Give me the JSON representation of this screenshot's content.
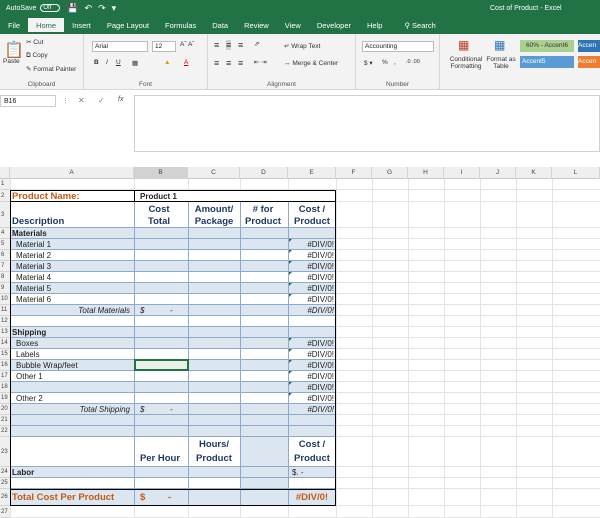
{
  "titlebar": {
    "autosave_label": "AutoSave",
    "autosave_state": "Off",
    "title": "Cost of Product - Excel",
    "search": "Search"
  },
  "tabs": [
    "File",
    "Home",
    "Insert",
    "Page Layout",
    "Formulas",
    "Data",
    "Review",
    "View",
    "Developer",
    "Help"
  ],
  "ribbon": {
    "clipboard": {
      "paste": "Paste",
      "cut": "Cut",
      "copy": "Copy",
      "format_painter": "Format Painter",
      "label": "Clipboard"
    },
    "font": {
      "name": "Arial",
      "size": "12",
      "label": "Font"
    },
    "alignment": {
      "wrap": "Wrap Text",
      "merge": "Merge & Center",
      "label": "Alignment"
    },
    "number": {
      "format": "Accounting",
      "label": "Number"
    },
    "styles": {
      "conditional": "Conditional Formatting",
      "format_table": "Format as Table",
      "style1": "60% - Accent6",
      "style2": "Accent5",
      "style3": "Accen",
      "style4": "Accen"
    }
  },
  "formula_bar": {
    "name_box": "B16",
    "fx": "fx"
  },
  "columns": [
    "A",
    "B",
    "C",
    "D",
    "E",
    "F",
    "G",
    "H",
    "I",
    "J",
    "K",
    "L"
  ],
  "colors": {
    "header_blue": "#1f3864",
    "label_orange": "#c55a11",
    "band": "#dce6f1",
    "excel_green": "#217346"
  },
  "sheet": {
    "product_name_label": "Product Name:",
    "product_name_value": "Product 1",
    "h_cost_total": [
      "Cost",
      "Total"
    ],
    "h_amount": [
      "Amount/",
      "Package"
    ],
    "h_for": [
      "# for",
      "Product"
    ],
    "h_cost_product": [
      "Cost /",
      "Product"
    ],
    "description": "Description",
    "materials": "Materials",
    "material_items": [
      "Material 1",
      "Material 2",
      "Material 3",
      "Material 4",
      "Material 5",
      "Material 6"
    ],
    "total_materials": "Total Materials",
    "dollar": "$",
    "dash": "-",
    "div": "#DIV/0!",
    "shipping": "Shipping",
    "shipping_items": [
      "Boxes",
      "Labels",
      "Bubble Wrap/feet",
      "Other 1",
      "",
      "Other 2"
    ],
    "total_shipping": "Total Shipping",
    "h_hours": [
      "Hours/",
      "Product"
    ],
    "per_hour": "Per Hour",
    "labor": "Labor",
    "labor_cost": "$.    -",
    "total_cost": "Total Cost Per Product"
  }
}
